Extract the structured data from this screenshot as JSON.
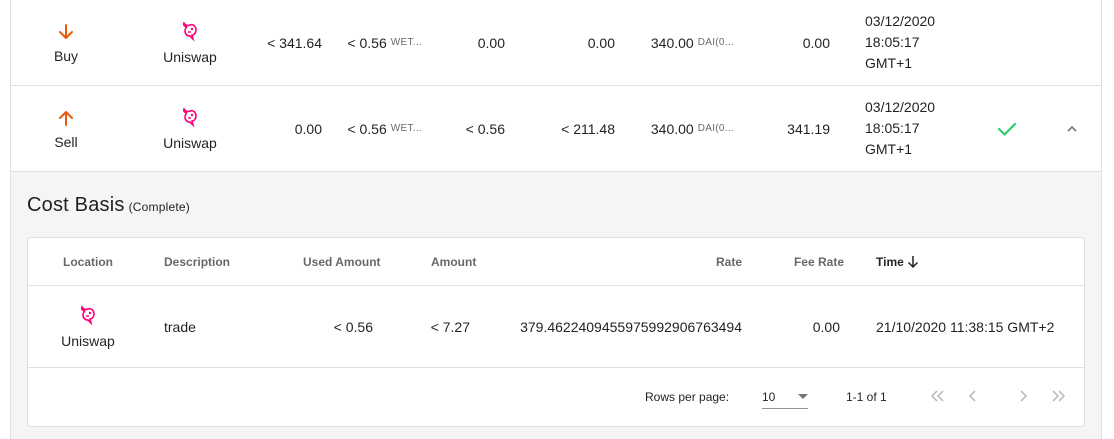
{
  "colors": {
    "buy_arrow": "#e8590c",
    "sell_arrow": "#e8590c",
    "check": "#2ecc71",
    "uniswap": "#ff007a"
  },
  "trades": [
    {
      "type": "Buy",
      "type_icon": "arrow-down-icon",
      "location": "Uniswap",
      "col1": "< 341.64",
      "col2_value": "< 0.56",
      "col2_unit": "WET...",
      "col3": "0.00",
      "col4": "0.00",
      "col5_value": "340.00",
      "col5_unit": "DAI(0...",
      "col6": "0.00",
      "time_line1": "03/12/2020",
      "time_line2": "18:05:17",
      "time_line3": "GMT+1"
    },
    {
      "type": "Sell",
      "type_icon": "arrow-up-icon",
      "location": "Uniswap",
      "col1": "0.00",
      "col2_value": "< 0.56",
      "col2_unit": "WET...",
      "col3": "< 0.56",
      "col4": "< 211.48",
      "col5_value": "340.00",
      "col5_unit": "DAI(0...",
      "col6": "341.19",
      "time_line1": "03/12/2020",
      "time_line2": "18:05:17",
      "time_line3": "GMT+1"
    }
  ],
  "cost_basis": {
    "title": "Cost Basis",
    "status": "(Complete)",
    "headers": {
      "location": "Location",
      "description": "Description",
      "used_amount": "Used Amount",
      "amount": "Amount",
      "rate": "Rate",
      "fee_rate": "Fee Rate",
      "time": "Time"
    },
    "rows": [
      {
        "location": "Uniswap",
        "description": "trade",
        "used_amount": "< 0.56",
        "amount": "< 7.27",
        "rate": "379.46224094559759929067634​94",
        "fee_rate": "0.00",
        "time": "21/10/2020 11:38:15 GMT+2"
      }
    ],
    "footer": {
      "rows_per_page_label": "Rows per page:",
      "rows_per_page_value": "10",
      "range": "1-1 of 1"
    }
  }
}
